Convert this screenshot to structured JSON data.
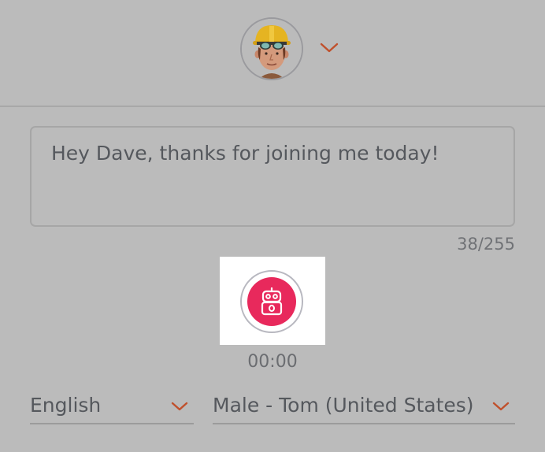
{
  "avatar": {
    "icon": "construction-worker-avatar",
    "dropdown_icon": "chevron-down-icon"
  },
  "message": {
    "text": "Hey Dave, thanks for joining me today!",
    "counter": "38/255"
  },
  "recorder": {
    "icon": "robot-icon",
    "time": "00:00"
  },
  "language_select": {
    "value": "English"
  },
  "voice_select": {
    "value": "Male - Tom (United States)"
  },
  "colors": {
    "accent": "#c0502c",
    "record": "#e8295c",
    "background": "#bbbbbb"
  }
}
